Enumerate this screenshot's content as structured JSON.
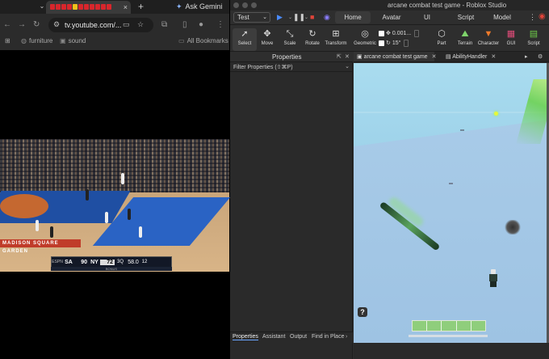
{
  "chrome": {
    "tab_close": "×",
    "new_tab": "+",
    "ask_gemini": "Ask Gemini",
    "url": "tv.youtube.com/...",
    "bookmarks": [
      "furniture",
      "sound"
    ],
    "all_bookmarks": "All Bookmarks",
    "tab_title_colors": [
      "#d8262c",
      "#f2c11a"
    ]
  },
  "video": {
    "scoreboard": {
      "network": "ESPN",
      "away_team": "SA",
      "away_score": "90",
      "home_team": "NY",
      "home_score": "72",
      "quarter": "3Q",
      "clock": "58.0",
      "shot_clock": "12",
      "bonus": "BONUS"
    },
    "arena_signage": "MADISON SQUARE GARDEN"
  },
  "studio": {
    "window_title": "arcane combat test game - Roblox Studio",
    "mode": "Test",
    "menu_tabs": [
      {
        "label": "Home",
        "active": true
      },
      {
        "label": "Avatar",
        "active": false
      },
      {
        "label": "UI",
        "active": false
      },
      {
        "label": "Script",
        "active": false
      },
      {
        "label": "Model",
        "active": false
      }
    ],
    "tools": [
      {
        "label": "Select",
        "icon": "cursor-icon"
      },
      {
        "label": "Move",
        "icon": "move-icon"
      },
      {
        "label": "Scale",
        "icon": "scale-icon"
      },
      {
        "label": "Rotate",
        "icon": "rotate-icon"
      },
      {
        "label": "Transform",
        "icon": "transform-icon"
      },
      {
        "label": "Geometric",
        "icon": "geometric-icon"
      }
    ],
    "snap_move": "0.001...",
    "snap_rotate": "15°",
    "insert_tools": [
      "Part",
      "Terrain",
      "Character",
      "GUI",
      "Script"
    ],
    "properties": {
      "title": "Properties",
      "filter_placeholder": "Filter Properties (⇧⌘P)"
    },
    "bottom_tabs": [
      "Properties",
      "Assistant",
      "Output",
      "Find in Place"
    ],
    "doc_tabs": [
      {
        "label": "arcane combat test game",
        "active": true
      },
      {
        "label": "AbilityHandler",
        "active": false
      }
    ],
    "help_label": "?",
    "healthbar_segments": 5
  }
}
